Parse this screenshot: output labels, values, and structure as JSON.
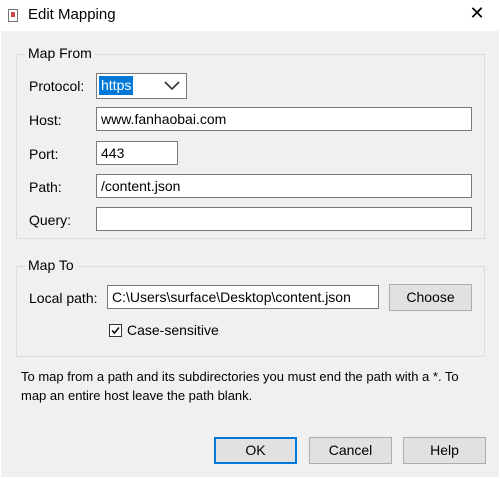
{
  "window": {
    "title": "Edit Mapping",
    "close_glyph": "✕",
    "icon": "document-icon"
  },
  "map_from": {
    "title": "Map From",
    "protocol": {
      "label": "Protocol:",
      "value": "https"
    },
    "host": {
      "label": "Host:",
      "value": "www.fanhaobai.com"
    },
    "port": {
      "label": "Port:",
      "value": "443"
    },
    "path": {
      "label": "Path:",
      "value": "/content.json"
    },
    "query": {
      "label": "Query:",
      "value": ""
    }
  },
  "map_to": {
    "title": "Map To",
    "local_path": {
      "label": "Local path:",
      "value": "C:\\Users\\surface\\Desktop\\content.json"
    },
    "choose_label": "Choose",
    "case_sensitive": {
      "label": "Case-sensitive",
      "checked": true
    }
  },
  "help_text": "To map from a path and its subdirectories you must end the path with a *. To map an entire host leave the path blank.",
  "buttons": {
    "ok": "OK",
    "cancel": "Cancel",
    "help": "Help"
  }
}
